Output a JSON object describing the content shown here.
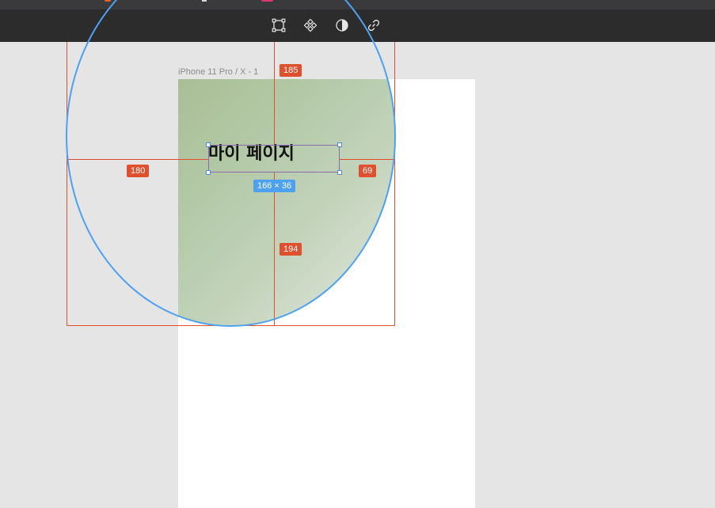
{
  "toolbar": {
    "tools": [
      {
        "name": "transform",
        "icon": "transform-icon"
      },
      {
        "name": "component",
        "icon": "component-icon"
      },
      {
        "name": "mask",
        "icon": "mask-icon"
      },
      {
        "name": "link",
        "icon": "link-icon"
      }
    ]
  },
  "canvas": {
    "artboard_label": "iPhone 11 Pro / X - 1",
    "heading_text": "마이 페이지",
    "selection_size": "166 × 36",
    "distances": {
      "top": "185",
      "left": "180",
      "right": "69",
      "bottom": "194"
    }
  },
  "colors": {
    "guide": "#e0502f",
    "selection_outline": "#4ea1f0",
    "toolbar_bg": "#2c2c2c",
    "canvas_bg": "#e5e5e5"
  }
}
